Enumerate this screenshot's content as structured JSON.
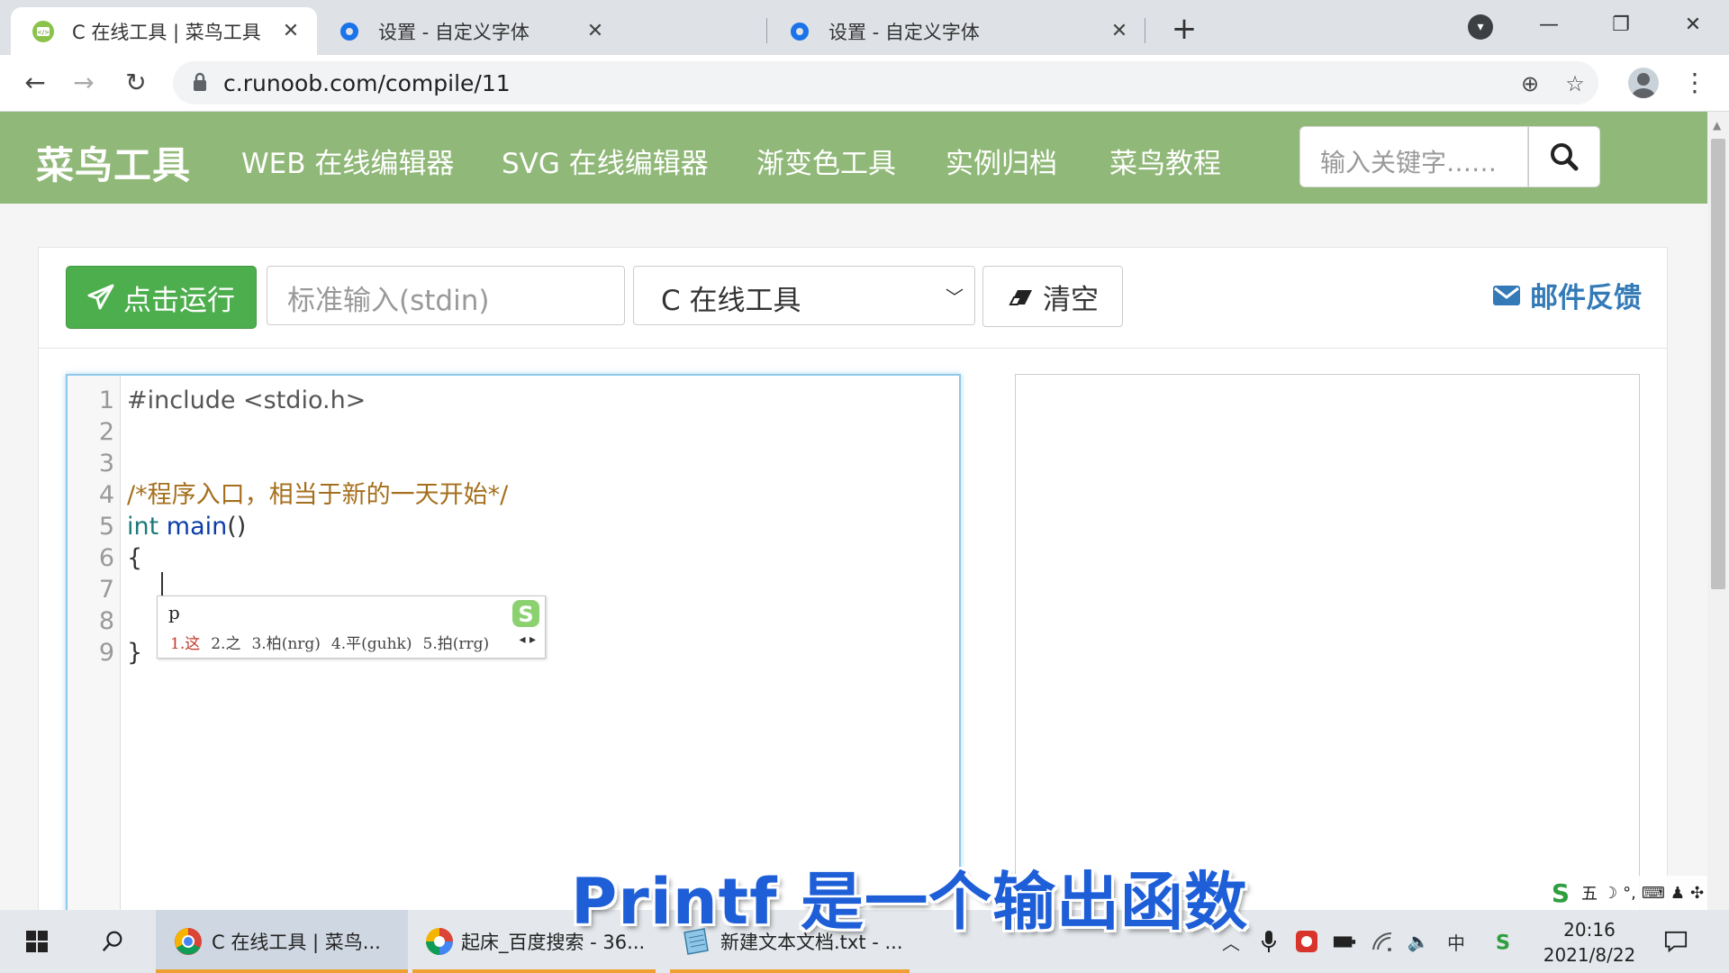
{
  "browser": {
    "tabs": [
      {
        "title": "C 在线工具 | 菜鸟工具",
        "active": true
      },
      {
        "title": "设置 - 自定义字体",
        "active": false
      },
      {
        "title": "设置 - 自定义字体",
        "active": false
      }
    ],
    "new_tab_label": "+",
    "url": "c.runoob.com/compile/11",
    "window_controls": {
      "minimize": "—",
      "restore": "❐",
      "close": "✕"
    }
  },
  "site": {
    "brand": "菜鸟工具",
    "nav": [
      "WEB 在线编辑器",
      "SVG 在线编辑器",
      "渐变色工具",
      "实例归档",
      "菜鸟教程"
    ],
    "search_placeholder": "输入关键字……"
  },
  "toolbar": {
    "run_label": "点击运行",
    "stdin_placeholder": "标准输入(stdin)",
    "language_selected": "C 在线工具",
    "clear_label": "清空",
    "feedback_label": "邮件反馈"
  },
  "editor": {
    "lines": [
      {
        "num": "1",
        "text": "#include <stdio.h>",
        "kind": "pre"
      },
      {
        "num": "2",
        "text": "",
        "kind": "plain"
      },
      {
        "num": "3",
        "text": "",
        "kind": "plain"
      },
      {
        "num": "4",
        "text": "/*程序入口，相当于新的一天开始*/",
        "kind": "comment"
      },
      {
        "num": "5",
        "text_kw": "int",
        "text_fn": "main",
        "text_rest": "()",
        "kind": "fn"
      },
      {
        "num": "6",
        "text": "{",
        "kind": "plain"
      },
      {
        "num": "7",
        "text": "",
        "kind": "plain"
      },
      {
        "num": "8",
        "text": "",
        "kind": "plain"
      },
      {
        "num": "9",
        "text": "}",
        "kind": "plain"
      }
    ]
  },
  "ime_popup": {
    "typed": "p",
    "candidates": [
      "1.这",
      "2.之",
      "3.柏(nrg)",
      "4.平(guhk)",
      "5.拍(rrg)"
    ]
  },
  "ime_status": {
    "mode": "五"
  },
  "subtitle": "Printf 是一个输出函数",
  "taskbar": {
    "items": [
      {
        "label": "C 在线工具 | 菜鸟..."
      },
      {
        "label": "起床_百度搜索 - 36..."
      },
      {
        "label": "新建文本文档.txt - ..."
      }
    ],
    "tray_lang": "中",
    "time": "20:16",
    "date": "2021/8/22"
  },
  "colors": {
    "site_nav": "#90b878",
    "run_button": "#4cae4c",
    "feedback": "#337ab7",
    "subtitle": "#1e5fd8",
    "comment": "#a46f1c"
  }
}
